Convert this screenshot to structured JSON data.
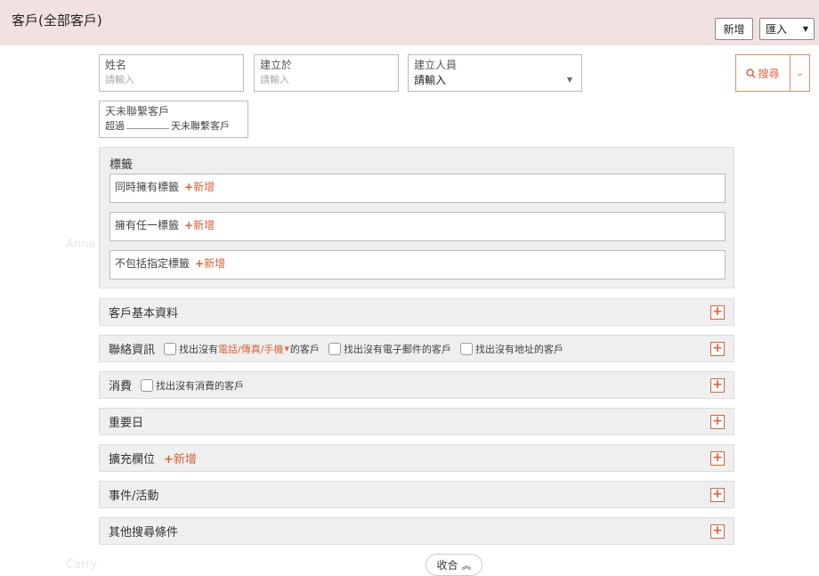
{
  "header": {
    "title": "客戶(全部客戶)",
    "add_label": "新增",
    "import_label": "匯入"
  },
  "filters": {
    "name": {
      "label": "姓名",
      "placeholder": "請輸入"
    },
    "created_at": {
      "label": "建立於",
      "placeholder": "請輸入"
    },
    "creator": {
      "label": "建立人員",
      "value": "請輸入"
    },
    "no_contact": {
      "label": "天未聯繫客戶",
      "prefix": "超過",
      "suffix": "天未聯繫客戶"
    },
    "search_label": "搜尋"
  },
  "tags": {
    "title": "標籤",
    "rows": [
      {
        "label": "同時擁有標籤",
        "add": "新增"
      },
      {
        "label": "擁有任一標籤",
        "add": "新增"
      },
      {
        "label": "不包括指定標籤",
        "add": "新增"
      }
    ]
  },
  "sections": {
    "basic": "客戶基本資料",
    "contact": "聯絡資訊",
    "contact_chk1_pre": "找出沒有",
    "contact_chk1_link": "電話/傳真/手機",
    "contact_chk1_post": "的客戶",
    "contact_chk2": "找出沒有電子郵件的客戶",
    "contact_chk3": "找出沒有地址的客戶",
    "spend": "消費",
    "spend_chk": "找出沒有消費的客戶",
    "important_date": "重要日",
    "custom": "擴充欄位",
    "custom_add": "新增",
    "events": "事件/活動",
    "other": "其他搜尋條件"
  },
  "collapse_label": "收合"
}
